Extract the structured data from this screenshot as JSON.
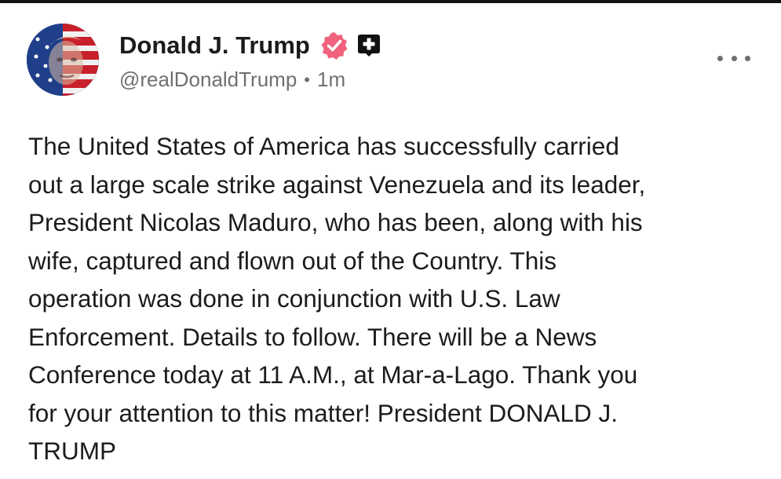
{
  "post": {
    "author": {
      "display_name": "Donald J. Trump",
      "handle": "@realDonaldTrump",
      "verified_icon": "verified-badge-icon",
      "extra_badge_icon": "plus-badge-icon",
      "avatar": "avatar"
    },
    "separator": "•",
    "timestamp": "1m",
    "more_icon": "more-options-icon",
    "body_lines": [
      "The United States of America has successfully carried",
      "out a large scale strike against Venezuela and its leader,",
      "President Nicolas Maduro, who has been, along with his",
      "wife, captured and flown out of the Country. This",
      "operation was done in conjunction with U.S. Law",
      "Enforcement. Details to follow. There will be a News",
      "Conference today at 11 A.M., at Mar-a-Lago. Thank you",
      "for your attention to this matter! President DONALD J.",
      "TRUMP"
    ]
  },
  "colors": {
    "text": "#1c1c1c",
    "secondary_text": "#707070",
    "verified_badge": "#f0627e",
    "plus_badge": "#111111",
    "background": "#ffffff"
  }
}
